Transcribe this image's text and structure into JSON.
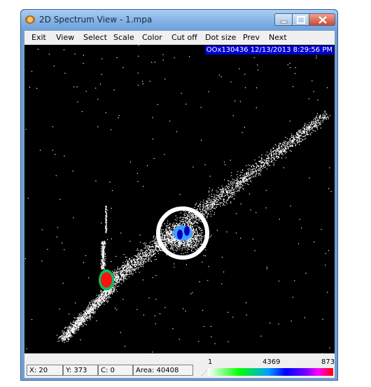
{
  "window": {
    "title": "2D Spectrum View - 1.mpa"
  },
  "menu": [
    "Exit",
    "View",
    "Select",
    "Scale",
    "Color",
    "Cut off",
    "Dot size",
    "Prev",
    "Next"
  ],
  "info_badge": "OOx130436 12/13/2013 8:29:56 PM",
  "status": {
    "x": "X:  20",
    "y": "Y:  373",
    "c": "C:  0",
    "area": "Area:  40408"
  },
  "colorbar": {
    "min_label": "1",
    "mid_label": "4369",
    "max_label": "873"
  },
  "colors": {
    "titlebar": "#7fb0e6",
    "plot_bg": "#000000",
    "badge": "#0000d0",
    "highlight_ring": "#ffffff"
  }
}
